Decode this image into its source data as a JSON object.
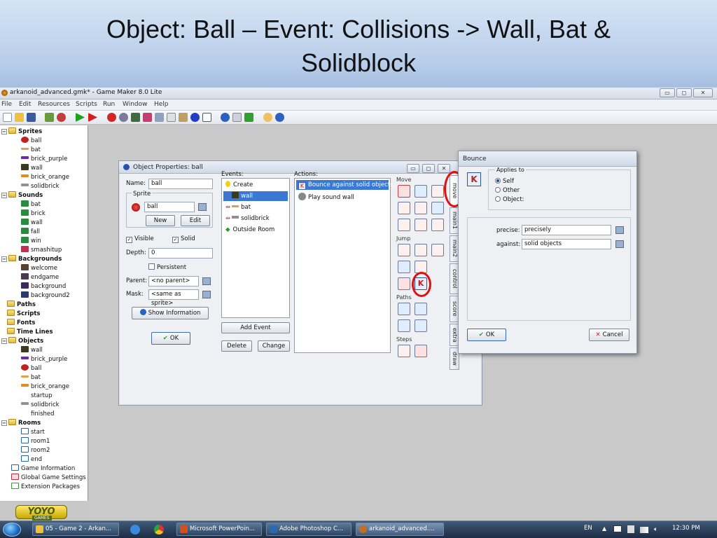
{
  "slide": {
    "title_line1": "Object: Ball – Event: Collisions -> Wall, Bat &",
    "title_line2": "Solidblock"
  },
  "window": {
    "title": "arkanoid_advanced.gmk* - Game Maker 8.0 Lite",
    "min": "▭",
    "max": "◻",
    "close": "✕"
  },
  "menu": [
    "File",
    "Edit",
    "Resources",
    "Scripts",
    "Run",
    "Window",
    "Help"
  ],
  "tree": {
    "sprites": {
      "label": "Sprites",
      "items": [
        "ball",
        "bat",
        "brick_purple",
        "wall",
        "brick_orange",
        "solidbrick"
      ]
    },
    "sounds": {
      "label": "Sounds",
      "items": [
        "bat",
        "brick",
        "wall",
        "fall",
        "win",
        "smashitup"
      ]
    },
    "backgrounds": {
      "label": "Backgrounds",
      "items": [
        "welcome",
        "endgame",
        "background",
        "background2"
      ]
    },
    "paths": "Paths",
    "scripts": "Scripts",
    "fonts": "Fonts",
    "timelines": "Time Lines",
    "objects": {
      "label": "Objects",
      "items": [
        "wall",
        "brick_purple",
        "ball",
        "bat",
        "brick_orange",
        "startup",
        "solidbrick",
        "finished"
      ]
    },
    "rooms": {
      "label": "Rooms",
      "items": [
        "start",
        "room1",
        "room2",
        "end"
      ]
    },
    "extras": [
      "Game Information",
      "Global Game Settings",
      "Extension Packages"
    ]
  },
  "yoyo": {
    "logo": "YOYO",
    "sub": "GAMES"
  },
  "objprops": {
    "title": "Object Properties: ball",
    "name_label": "Name:",
    "name_value": "ball",
    "sprite_label": "Sprite",
    "sprite_value": "ball",
    "new_btn": "New",
    "edit_btn": "Edit",
    "visible": "Visible",
    "solid": "Solid",
    "depth_label": "Depth:",
    "depth_value": "0",
    "persistent": "Persistent",
    "parent_label": "Parent:",
    "parent_value": "<no parent>",
    "mask_label": "Mask:",
    "mask_value": "<same as sprite>",
    "show_info": "Show Information",
    "ok": "OK",
    "events_label": "Events:",
    "events": [
      "Create",
      "wall",
      "bat",
      "solidbrick",
      "Outside Room"
    ],
    "add_event": "Add Event",
    "delete": "Delete",
    "change": "Change",
    "actions_label": "Actions:",
    "actions": [
      "Bounce against solid objects",
      "Play sound wall"
    ],
    "groups": {
      "move": "Move",
      "jump": "Jump",
      "paths": "Paths",
      "steps": "Steps"
    },
    "tabs": [
      "move",
      "main1",
      "main2",
      "control",
      "score",
      "extra",
      "draw"
    ]
  },
  "bounce": {
    "title": "Bounce",
    "applies_to": "Applies to",
    "self": "Self",
    "other": "Other",
    "object": "Object:",
    "precise_label": "precise:",
    "precise_value": "precisely",
    "against_label": "against:",
    "against_value": "solid objects",
    "ok": "OK",
    "cancel": "Cancel"
  },
  "taskbar": {
    "tasks": [
      "05 - Game 2 - Arkan...",
      "Microsoft PowerPoin...",
      "Adobe Photoshop C...",
      "arkanoid_advanced...."
    ],
    "lang": "EN",
    "time": "12:30 PM"
  },
  "colors": {
    "accent": "#3a78d6",
    "highlight": "#e01010"
  }
}
